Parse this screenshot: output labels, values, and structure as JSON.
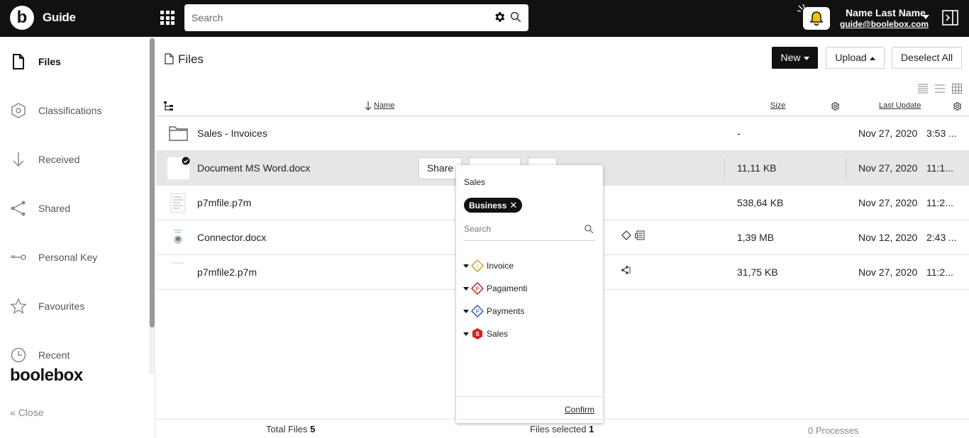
{
  "header": {
    "logo_letter": "b",
    "app_title": "Guide",
    "search_placeholder": "Search",
    "user_name": "Name Last Name",
    "user_email": "guide@boolebox.com"
  },
  "sidebar": {
    "items": [
      {
        "label": "Files",
        "icon": "file-icon",
        "active": true
      },
      {
        "label": "Classifications",
        "icon": "hexagon-icon",
        "active": false
      },
      {
        "label": "Received",
        "icon": "arrow-down-icon",
        "active": false
      },
      {
        "label": "Shared",
        "icon": "share-icon",
        "active": false
      },
      {
        "label": "Personal Key",
        "icon": "key-icon",
        "active": false
      },
      {
        "label": "Favourites",
        "icon": "star-icon",
        "active": false
      },
      {
        "label": "Recent",
        "icon": "clock-icon",
        "active": false
      }
    ],
    "brand": "boolebox",
    "close_label": "Close"
  },
  "main": {
    "title": "Files",
    "new_label": "New",
    "upload_label": "Upload",
    "deselect_label": "Deselect All",
    "columns": {
      "name": "Name",
      "size": "Size",
      "last_update": "Last Update"
    },
    "rows": [
      {
        "name": "Sales - Invoices",
        "size": "-",
        "date": "Nov 27, 2020",
        "time": "3:53 ...",
        "type": "folder"
      },
      {
        "name": "Document MS Word.docx",
        "size": "11,11 KB",
        "date": "Nov 27, 2020",
        "time": "11:1...",
        "type": "doc"
      },
      {
        "name": "p7mfile.p7m",
        "size": "538,64 KB",
        "date": "Nov 27, 2020",
        "time": "11:2...",
        "type": "p7m"
      },
      {
        "name": "Connector.docx",
        "size": "1,39 MB",
        "date": "Nov 12, 2020",
        "time": "2:43 ...",
        "type": "img"
      },
      {
        "name": "p7mfile2.p7m",
        "size": "31,75 KB",
        "date": "Nov 27, 2020",
        "time": "11:2...",
        "type": "p7m2"
      }
    ],
    "row_actions": {
      "share_label": "Share"
    }
  },
  "popup": {
    "title": "Sales",
    "chip_label": "Business",
    "search_placeholder": "Search",
    "items": [
      {
        "label": "Invoice",
        "letter": "I",
        "color": "#c9a227"
      },
      {
        "label": "Pagamenti",
        "letter": "P",
        "color": "#b22222"
      },
      {
        "label": "Payments",
        "letter": "P",
        "color": "#2a5ab8"
      },
      {
        "label": "Sales",
        "letter": "S",
        "color": "#d62020"
      }
    ],
    "confirm_label": "Confirm"
  },
  "footer": {
    "total_label": "Total Files",
    "total_value": "5",
    "selected_label": "Files selected",
    "selected_value": "1",
    "processes_value": "0",
    "processes_label": "Processes"
  }
}
